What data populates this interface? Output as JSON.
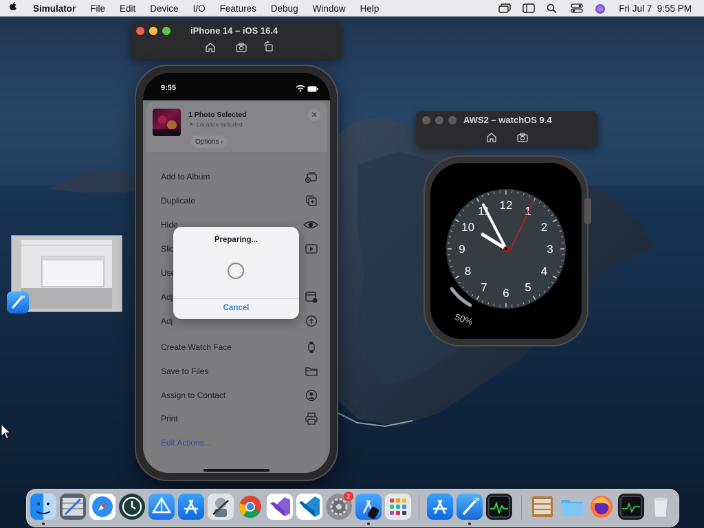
{
  "menubar": {
    "apple_icon": "apple-logo-icon",
    "app_name": "Simulator",
    "items": [
      "File",
      "Edit",
      "Device",
      "I/O",
      "Features",
      "Debug",
      "Window",
      "Help"
    ],
    "datetime": "Fri Jul 7  9:55 PM"
  },
  "iphone_window": {
    "title": "iPhone 14 – iOS 16.4",
    "tools": [
      "home-icon",
      "screenshot-icon",
      "rotate-icon"
    ]
  },
  "watch_window": {
    "title": "AWS2 – watchOS 9.4",
    "tools": [
      "home-icon",
      "screenshot-icon"
    ]
  },
  "iphone": {
    "time": "9:55",
    "sheet": {
      "header_title": "1 Photo Selected",
      "header_subtitle": "Location Included",
      "options_label": "Options",
      "actions": [
        {
          "label": "Add to Album",
          "icon": "add-to-album-icon"
        },
        {
          "label": "Duplicate",
          "icon": "duplicate-icon"
        },
        {
          "label": "Hide",
          "icon": "eye-icon"
        },
        {
          "label": "Slideshow",
          "icon": "play-icon"
        },
        {
          "label": "Use as Wallpaper",
          "icon": ""
        },
        {
          "label": "Adjust Date & Time",
          "icon": "calendar-icon"
        },
        {
          "label": "Adjust Location",
          "icon": "info-icon"
        },
        {
          "label": "Create Watch Face",
          "icon": "watch-icon"
        },
        {
          "label": "Save to Files",
          "icon": "folder-icon"
        },
        {
          "label": "Assign to Contact",
          "icon": "contact-icon"
        },
        {
          "label": "Print",
          "icon": "printer-icon"
        }
      ],
      "visible_labels": [
        "Add to Album",
        "Duplicate",
        "Hide",
        "Slic",
        "Use",
        "Adj",
        "Adj",
        "Create Watch Face",
        "Save to Files",
        "Assign to Contact",
        "Print"
      ],
      "edit_actions": "Edit Actions..."
    },
    "dialog": {
      "title": "Preparing...",
      "cancel": "Cancel"
    }
  },
  "watch": {
    "numbers": [
      "12",
      "1",
      "2",
      "3",
      "4",
      "5",
      "6",
      "7",
      "8",
      "9",
      "10",
      "11"
    ],
    "battery": "50%",
    "battery_level": 0.5
  },
  "dock": {
    "apps": [
      "finder-icon",
      "instruments-icon",
      "safari-icon",
      "time-machine-icon",
      "testflight-icon",
      "app-store-connect-icon",
      "automator-icon",
      "chrome-icon",
      "visual-studio-icon",
      "vscode-icon",
      "system-preferences-icon",
      "simulator-icon",
      "launchpad-icon",
      "app-store-icon",
      "xcode-icon",
      "activity-monitor-icon",
      "archive-icon",
      "folder-icon",
      "firefox-icon",
      "console-icon",
      "trash-icon"
    ],
    "badge": "2"
  },
  "colors": {
    "accent": "#1f4f9a",
    "watch_second_hand": "#e01515",
    "dialog_button": "#2c7be5"
  }
}
